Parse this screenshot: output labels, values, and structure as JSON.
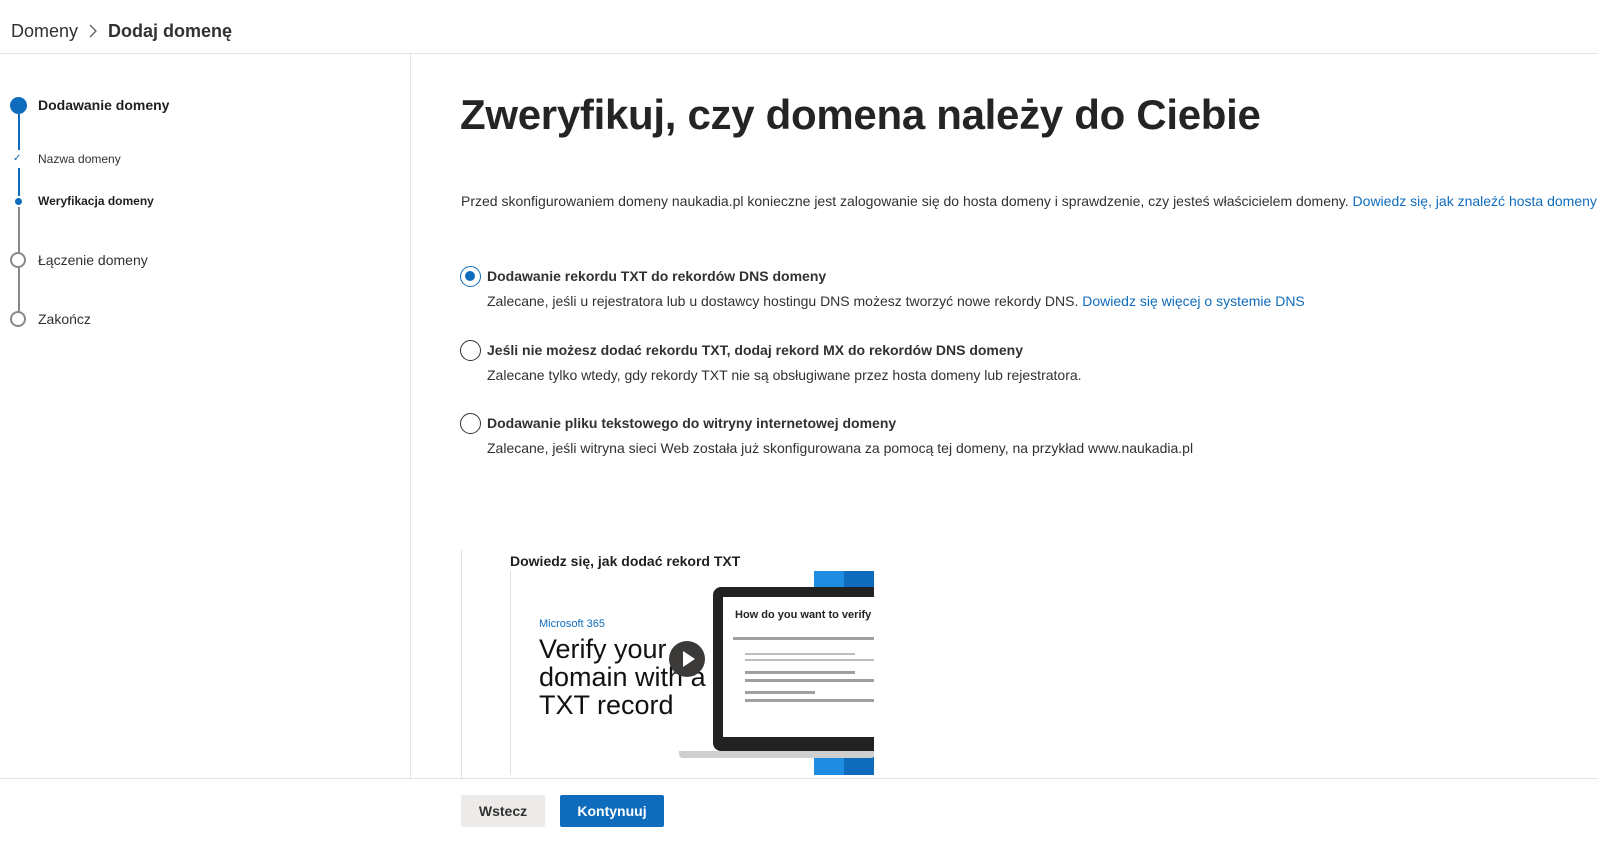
{
  "breadcrumb": {
    "parent": "Domeny",
    "current": "Dodaj domenę"
  },
  "steps": {
    "main": "Dodawanie domeny",
    "sub1": "Nazwa domeny",
    "sub2": "Weryfikacja domeny",
    "step3": "Łączenie domeny",
    "step4": "Zakończ"
  },
  "main": {
    "title": "Zweryfikuj, czy domena należy do Ciebie",
    "intro_text": "Przed skonfigurowaniem domeny naukadia.pl konieczne jest zalogowanie się do hosta domeny i sprawdzenie, czy jesteś właścicielem domeny. ",
    "intro_link": "Dowiedz się, jak znaleźć hosta domeny",
    "options": [
      {
        "title": "Dodawanie rekordu TXT do rekordów DNS domeny",
        "desc": "Zalecane, jeśli u rejestratora lub u dostawcy hostingu DNS możesz tworzyć nowe rekordy DNS. ",
        "link": "Dowiedz się więcej o systemie DNS",
        "checked": true
      },
      {
        "title": "Jeśli nie możesz dodać rekordu TXT, dodaj rekord MX do rekordów DNS domeny",
        "desc": "Zalecane tylko wtedy, gdy rekordy TXT nie są obsługiwane przez hosta domeny lub rejestratora.",
        "checked": false
      },
      {
        "title": "Dodawanie pliku tekstowego do witryny internetowej domeny",
        "desc": "Zalecane, jeśli witryna sieci Web została już skonfigurowana za pomocą tej domeny, na przykład www.naukadia.pl",
        "checked": false
      }
    ],
    "video": {
      "title": "Dowiedz się, jak dodać rekord TXT",
      "brand": "Microsoft 365",
      "headline": "Verify your domain with a TXT record",
      "screen_title": "How do you want to verify",
      "icon": "play-icon"
    }
  },
  "footer": {
    "back": "Wstecz",
    "next": "Kontynuuj"
  },
  "colors": {
    "accent": "#0f6cbd",
    "text": "#323130"
  }
}
